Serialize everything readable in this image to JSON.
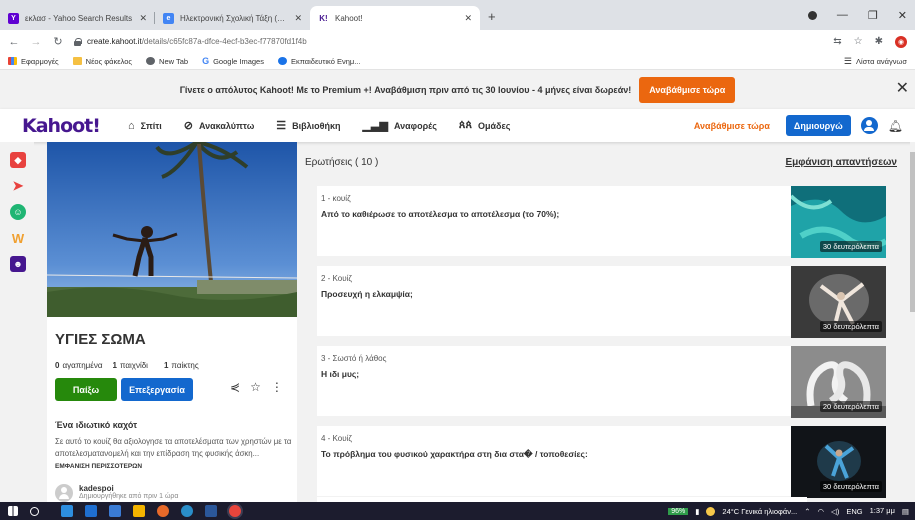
{
  "browser": {
    "tabs": [
      {
        "title": "εκλασ - Yahoo Search Results",
        "favicon_color": "#6001d2",
        "favicon_letter": "Y"
      },
      {
        "title": "Ηλεκτρονική Σχολική Τάξη (η-Τά",
        "favicon_color": "#4285f4",
        "favicon_letter": "e"
      },
      {
        "title": "Kahoot!",
        "favicon_color": "#46178f",
        "favicon_letter": "K!"
      }
    ],
    "url_host": "create.kahoot.it",
    "url_path": "/details/c65fc87a-dfce-4ecf-b3ec-f77870fd1f4b",
    "bookmarks": [
      {
        "label": "Εφαρμογές",
        "color": "#e94335"
      },
      {
        "label": "Νέος φάκελος",
        "color": "#f5c042"
      },
      {
        "label": "New Tab",
        "color": "#5f6368"
      },
      {
        "label": "Google Images",
        "color": "#4285f4"
      },
      {
        "label": "Εκπαιδευτικό Ενημ...",
        "color": "#1a73e8"
      }
    ],
    "reading_list": "Λίστα ανάγνωσ"
  },
  "banner": {
    "text": "Γίνετε ο απόλυτος Kahoot! Με το Premium +! Αναβάθμιση πριν από τις 30 Ιουνίου - 4 μήνες είναι δωρεάν!",
    "button": "Αναβάθμισε τώρα"
  },
  "header": {
    "logo": "Kahoot!",
    "nav": [
      {
        "label": "Σπίτι",
        "icon": "home-icon"
      },
      {
        "label": "Ανακαλύπτω",
        "icon": "compass-icon"
      },
      {
        "label": "Βιβλιοθήκη",
        "icon": "list-icon"
      },
      {
        "label": "Αναφορές",
        "icon": "chart-icon"
      },
      {
        "label": "Ομάδες",
        "icon": "groups-icon"
      }
    ],
    "upgrade": "Αναβάθμισε τώρα",
    "create": "Δημιουργώ"
  },
  "kahoot": {
    "title": "ΥΓΙΕΣ ΣΩΜΑ",
    "favorites_count": "0",
    "favorites_label": "αγαπημένα",
    "plays_count": "1",
    "plays_label": "παιχνίδι",
    "players_count": "1",
    "players_label": "παίκτης",
    "play": "Παίξω",
    "edit": "Επεξεργασία",
    "privacy": "Ένα ιδιωτικό καχότ",
    "description": "Σε αυτό το κουίζ θα αξιολογησε τα αποτελέσματα των χρηστών με τα αποτελεσματανομελή και την επίδραση της φυσικής άσκη...",
    "show_more": "ΕΜΦΑΝΙΣΗ ΠΕΡΙΣΣΟΤΕΡΩΝ",
    "owner": "kadespoi",
    "owner_sub": "Δημιουργήθηκε από πριν 1 ώρα"
  },
  "questions": {
    "header": "Ερωτήσεις ( 10 )",
    "show_answers": "Εμφάνιση απαντήσεων",
    "items": [
      {
        "type": "1 - κουίζ",
        "text": "Από το καθιέρωσε το αποτέλεσμα το αποτέλεσμα (το 70%);",
        "time": "30 δευτερόλεπτα",
        "thumb": "reef"
      },
      {
        "type": "2 - Κουίζ",
        "text": "Προσευχή η ελκαμψία;",
        "time": "30 δευτερόλεπτα",
        "thumb": "dancer"
      },
      {
        "type": "3 - Σωστό ή λάθος",
        "text": "Η ιδι μυς;",
        "time": "20 δευτερόλεπτα",
        "thumb": "swans"
      },
      {
        "type": "4 - Κουίζ",
        "text": "Το πρόβλημα του φυσικού χαρακτήρα στη δια στα� / τοποθεσίες:",
        "time": "30 δευτερόλεπτα",
        "thumb": "jump"
      }
    ]
  },
  "taskbar": {
    "battery": "96%",
    "weather": "24°C Γενικά ηλιοφάν...",
    "lang": "ENG",
    "time": "1:37 μμ"
  }
}
